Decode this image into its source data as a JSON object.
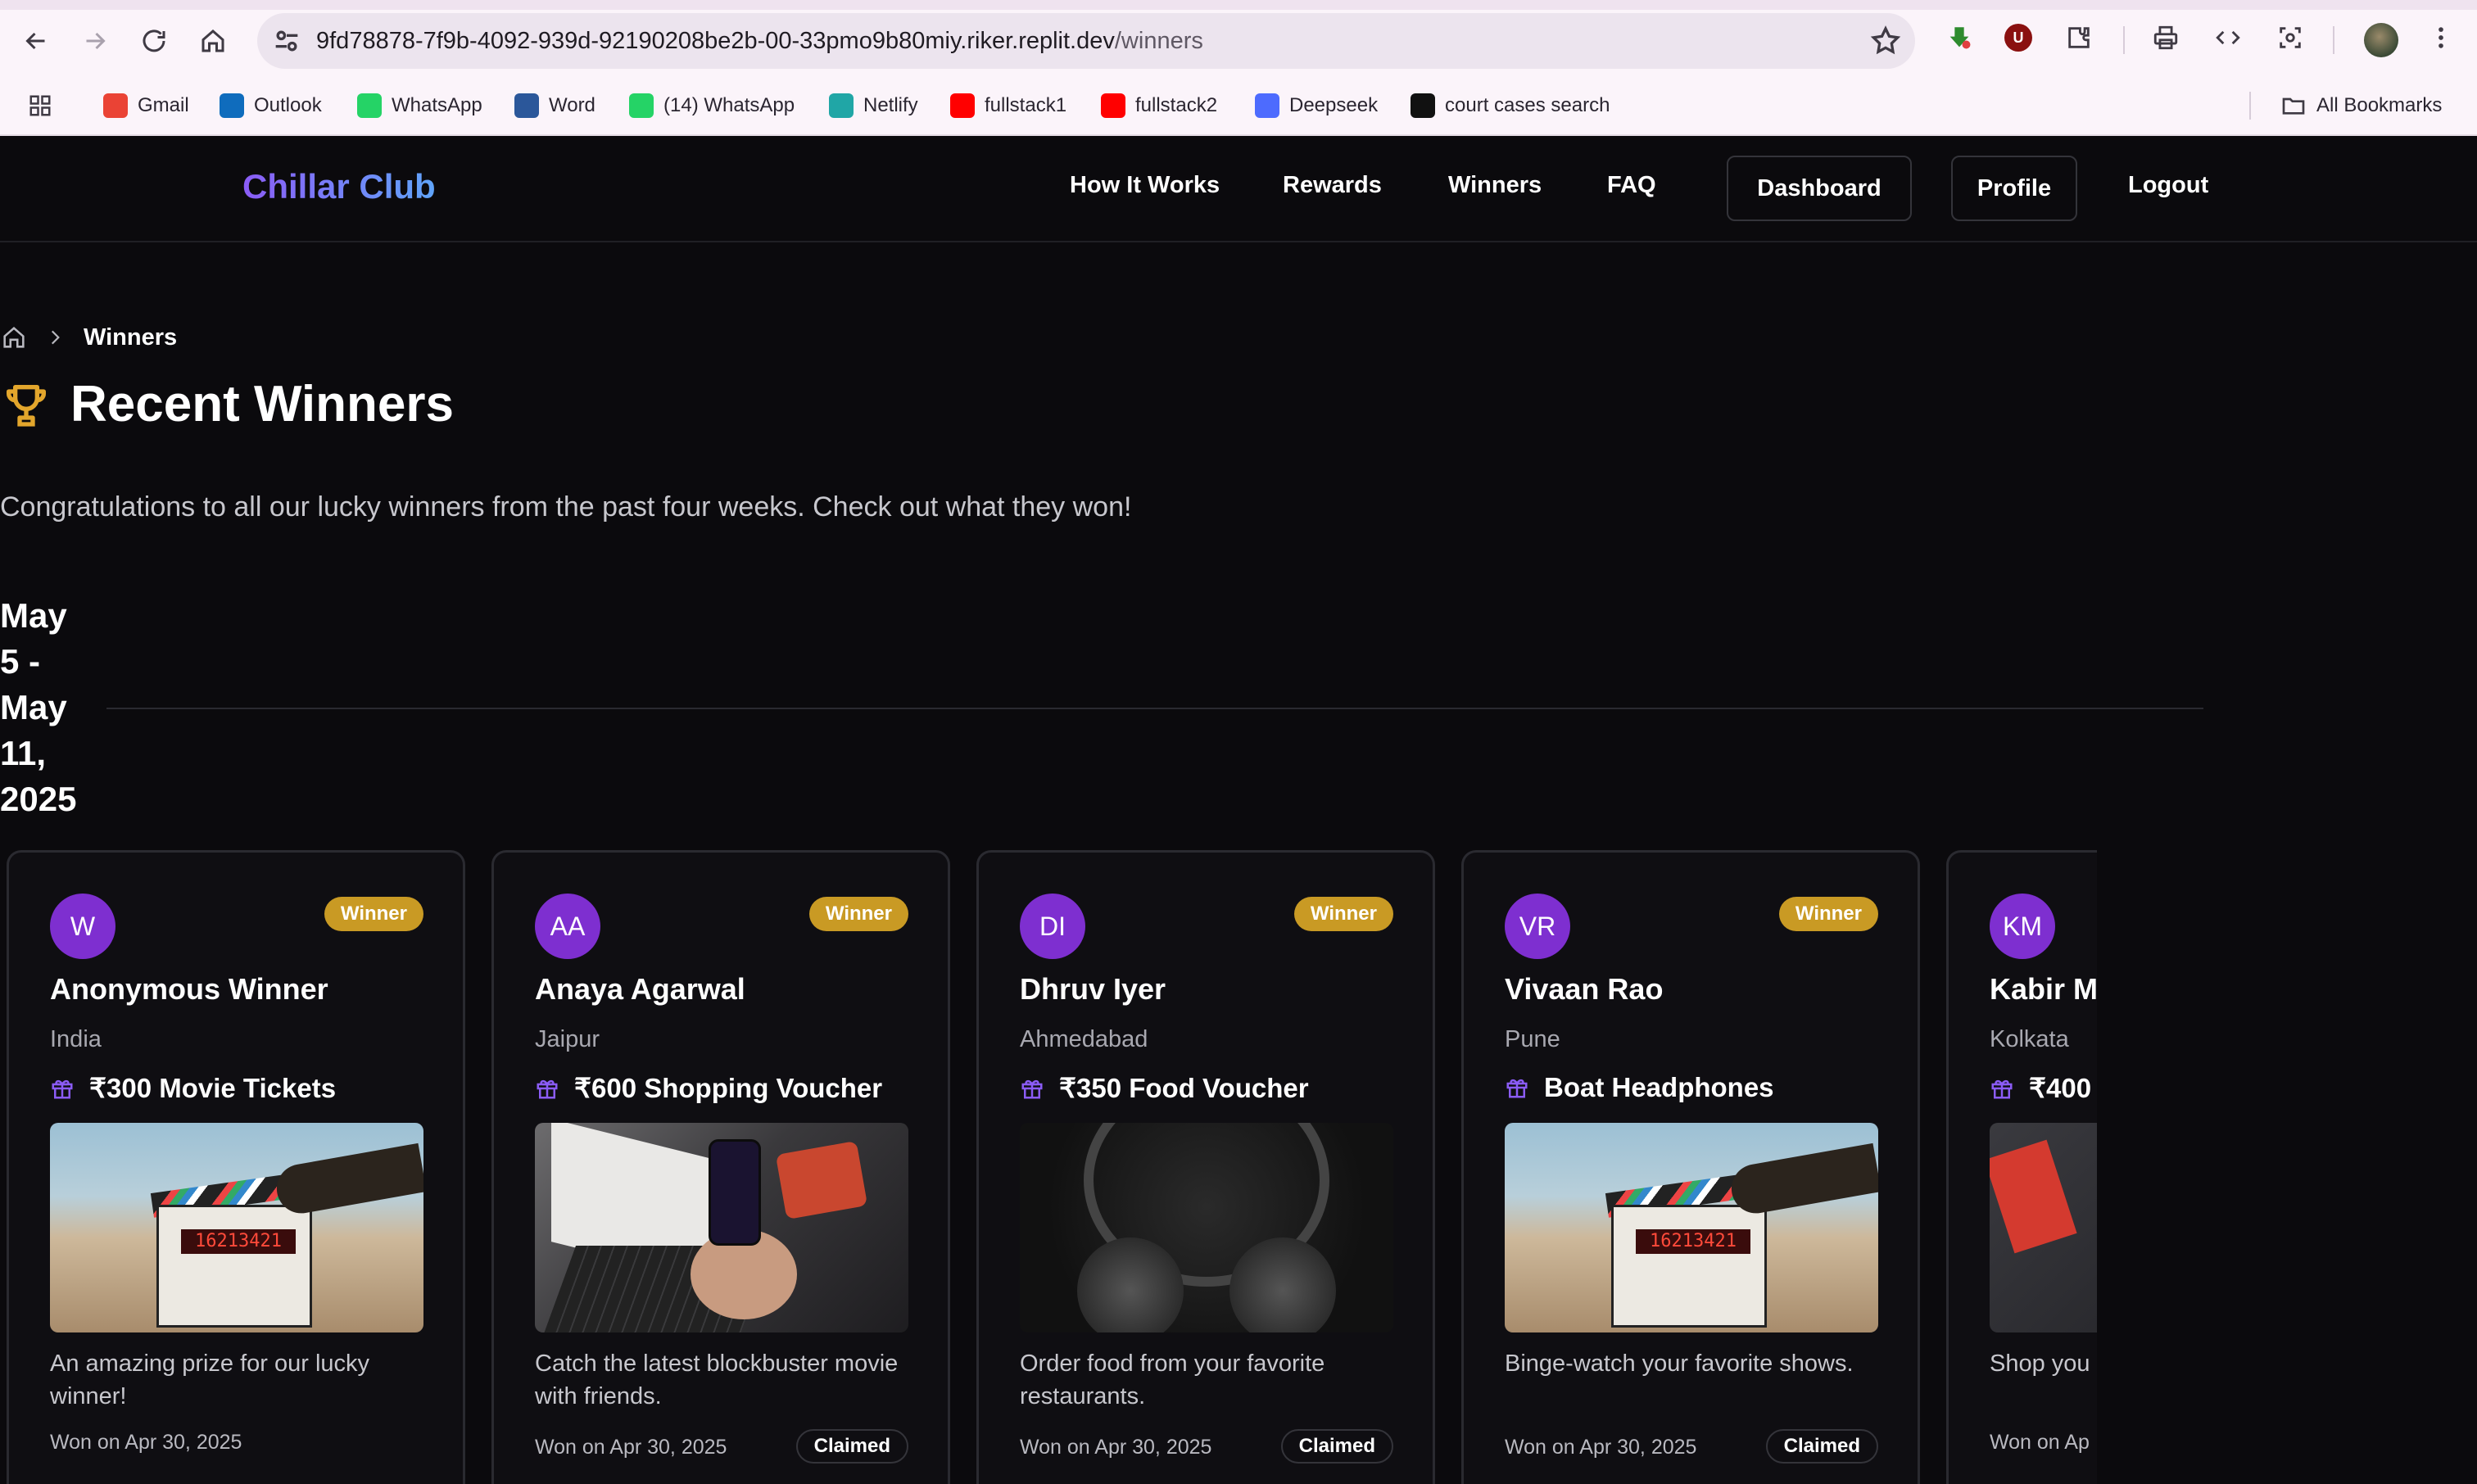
{
  "browser": {
    "url_host": "9fd78878-7f9b-4092-939d-92190208be2b-00-33pmo9b80miy.riker.replit.dev",
    "url_path": "/winners",
    "bookmarks": [
      {
        "label": "Gmail",
        "icon": "gmail-icon",
        "color": "#ea4335"
      },
      {
        "label": "Outlook",
        "icon": "outlook-icon",
        "color": "#0f6cbd"
      },
      {
        "label": "WhatsApp",
        "icon": "whatsapp-icon",
        "color": "#25d366"
      },
      {
        "label": "Word",
        "icon": "word-icon",
        "color": "#2b579a"
      },
      {
        "label": "(14) WhatsApp",
        "icon": "whatsapp-icon",
        "color": "#25d366"
      },
      {
        "label": "Netlify",
        "icon": "netlify-icon",
        "color": "#20a6a6"
      },
      {
        "label": "fullstack1",
        "icon": "youtube-icon",
        "color": "#ff0000"
      },
      {
        "label": "fullstack2",
        "icon": "youtube-icon",
        "color": "#ff0000"
      },
      {
        "label": "Deepseek",
        "icon": "deepseek-icon",
        "color": "#4d6bfe"
      },
      {
        "label": "court cases search",
        "icon": "court-icon",
        "color": "#111111"
      }
    ],
    "all_bookmarks": "All Bookmarks",
    "extension_badge": "U"
  },
  "site": {
    "logo": "Chillar Club",
    "nav": {
      "how_it_works": "How It Works",
      "rewards": "Rewards",
      "winners": "Winners",
      "faq": "FAQ",
      "dashboard": "Dashboard",
      "profile": "Profile",
      "logout": "Logout"
    },
    "breadcrumb_current": "Winners",
    "title": "Recent Winners",
    "subtitle": "Congratulations to all our lucky winners from the past four weeks. Check out what they won!",
    "week_label": "May 5 - May 11, 2025",
    "accent_color": "#7e2fd0",
    "badge_color": "#c99a24"
  },
  "winners": [
    {
      "initials": "W",
      "badge": "Winner",
      "name": "Anonymous Winner",
      "city": "India",
      "prize": "₹300 Movie Tickets",
      "desc": "An amazing prize for our lucky winner!",
      "won": "Won on Apr 30, 2025",
      "status": "",
      "photo": "clapperboard"
    },
    {
      "initials": "AA",
      "badge": "Winner",
      "name": "Anaya Agarwal",
      "city": "Jaipur",
      "prize": "₹600 Shopping Voucher",
      "desc": "Catch the latest blockbuster movie with friends.",
      "won": "Won on Apr 30, 2025",
      "status": "Claimed",
      "photo": "laptop-phone"
    },
    {
      "initials": "DI",
      "badge": "Winner",
      "name": "Dhruv Iyer",
      "city": "Ahmedabad",
      "prize": "₹350 Food Voucher",
      "desc": "Order food from your favorite restaurants.",
      "won": "Won on Apr 30, 2025",
      "status": "Claimed",
      "photo": "headphones"
    },
    {
      "initials": "VR",
      "badge": "Winner",
      "name": "Vivaan Rao",
      "city": "Pune",
      "prize": "Boat Headphones",
      "desc": "Binge-watch your favorite shows.",
      "won": "Won on Apr 30, 2025",
      "status": "Claimed",
      "photo": "clapperboard"
    },
    {
      "initials": "KM",
      "badge": "",
      "name": "Kabir M",
      "city": "Kolkata",
      "prize": "₹400",
      "desc": "Shop you this vouch",
      "won": "Won on Ap",
      "status": "",
      "photo": "shopping"
    }
  ]
}
